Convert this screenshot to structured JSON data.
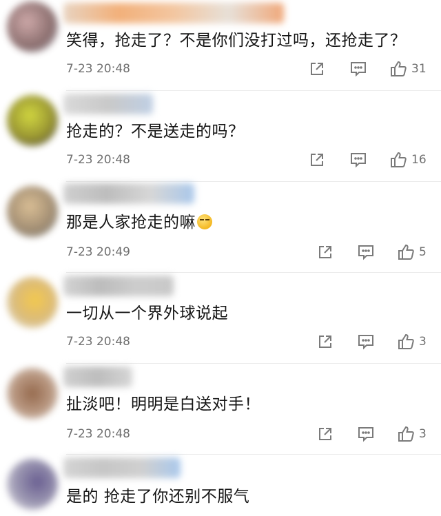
{
  "colors": {
    "text": "#151515",
    "meta": "#6f6f6f",
    "icon": "#7a7a7a",
    "divider": "#ebebeb",
    "background": "#ffffff"
  },
  "comments": [
    {
      "text": "笑得，抢走了？不是你们没打过吗，还抢走了？",
      "time": "7-23 20:48",
      "likes": "31",
      "icons": [
        "share-icon",
        "reply-icon",
        "thumbs-up-icon"
      ]
    },
    {
      "text": "抢走的？不是送走的吗？",
      "time": "7-23 20:48",
      "likes": "16",
      "icons": [
        "share-icon",
        "reply-icon",
        "thumbs-up-icon"
      ]
    },
    {
      "text": "那是人家抢走的嘛",
      "emoji": "smirk-emoji",
      "time": "7-23 20:49",
      "likes": "5",
      "icons": [
        "share-icon",
        "reply-icon",
        "thumbs-up-icon"
      ]
    },
    {
      "text": "一切从一个界外球说起",
      "time": "7-23 20:48",
      "likes": "3",
      "icons": [
        "share-icon",
        "reply-icon",
        "thumbs-up-icon"
      ]
    },
    {
      "text": "扯淡吧！明明是白送对手！",
      "time": "7-23 20:48",
      "likes": "3",
      "icons": [
        "share-icon",
        "reply-icon",
        "thumbs-up-icon"
      ]
    },
    {
      "text": "是的 抢走了你还别不服气"
    }
  ]
}
